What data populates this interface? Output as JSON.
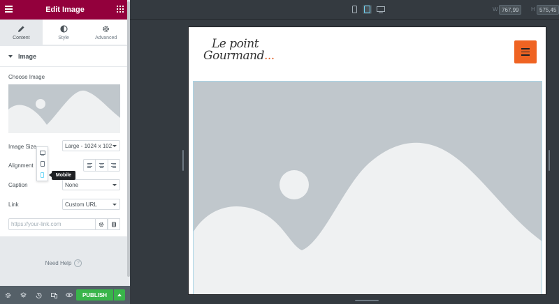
{
  "panel": {
    "title": "Edit Image",
    "tabs": [
      {
        "label": "Content",
        "icon": "pencil-icon",
        "active": true
      },
      {
        "label": "Style",
        "icon": "contrast-icon",
        "active": false
      },
      {
        "label": "Advanced",
        "icon": "gear-icon",
        "active": false
      }
    ],
    "section_title": "Image",
    "choose_image_label": "Choose Image",
    "image_size_label": "Image Size",
    "image_size_value": "Large - 1024 x 102",
    "alignment_label": "Alignment",
    "caption_label": "Caption",
    "caption_value": "None",
    "link_label": "Link",
    "link_value": "Custom URL",
    "link_placeholder": "https://your-link.com",
    "device_tooltip": "Mobile",
    "help_label": "Need Help",
    "publish_label": "PUBLISH"
  },
  "topbar": {
    "width_label": "W",
    "width_value": "767,99",
    "height_label": "H",
    "height_value": "575,45",
    "active_device": "tablet"
  },
  "preview": {
    "logo_line1": "Le point",
    "logo_line2": "Gourmand",
    "logo_ellipsis": "..."
  },
  "colors": {
    "brand": "#93003c",
    "publish": "#39b54a",
    "menu_button": "#ef6322",
    "placeholder_bg": "#c0c7cc"
  }
}
